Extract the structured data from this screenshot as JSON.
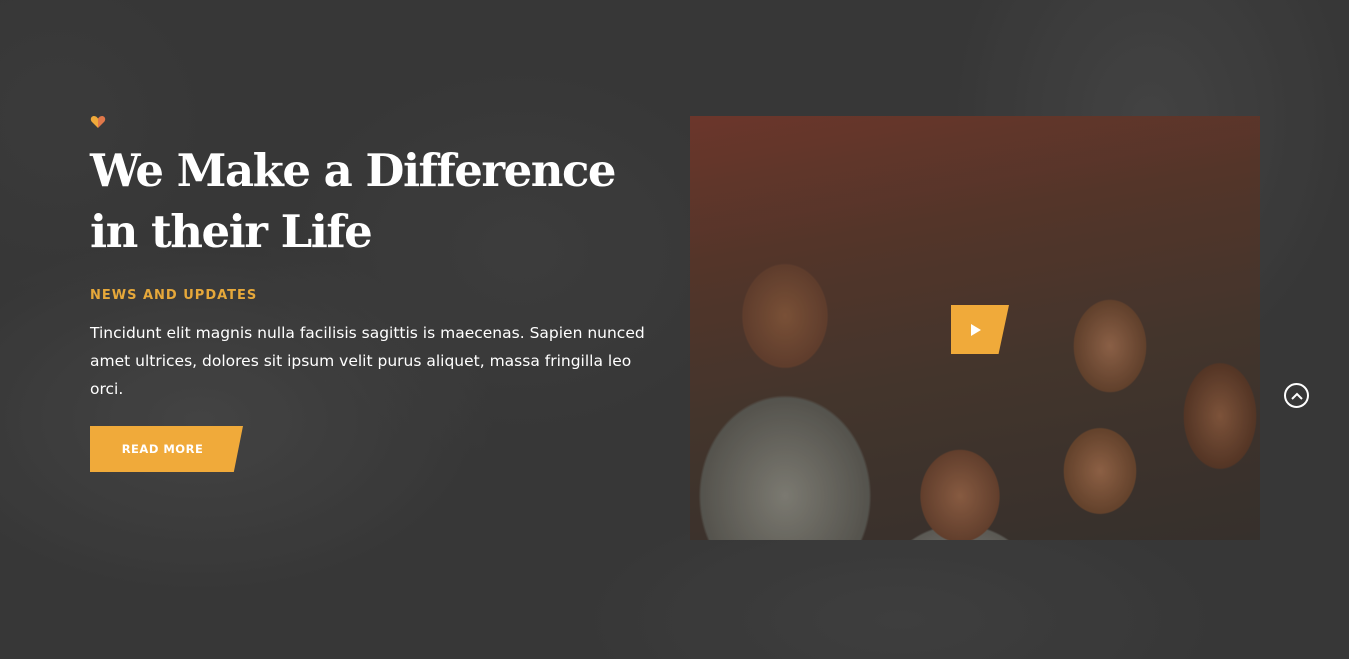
{
  "hero": {
    "title": "We Make a Difference in their Life",
    "subtitle": "NEWS AND UPDATES",
    "description": "Tincidunt elit magnis nulla facilisis sagittis is maecenas. Sapien nunced amet ultrices, dolores sit ipsum velit purus aliquet, massa fringilla leo orci.",
    "read_more_label": "READ MORE"
  },
  "icons": {
    "heart": "heart-icon",
    "play": "play-icon",
    "scroll_top": "chevron-up-icon"
  },
  "colors": {
    "accent": "#f0aa3a",
    "subtitle": "#e6a83a",
    "background": "#3f3f3f",
    "text": "#ffffff"
  }
}
